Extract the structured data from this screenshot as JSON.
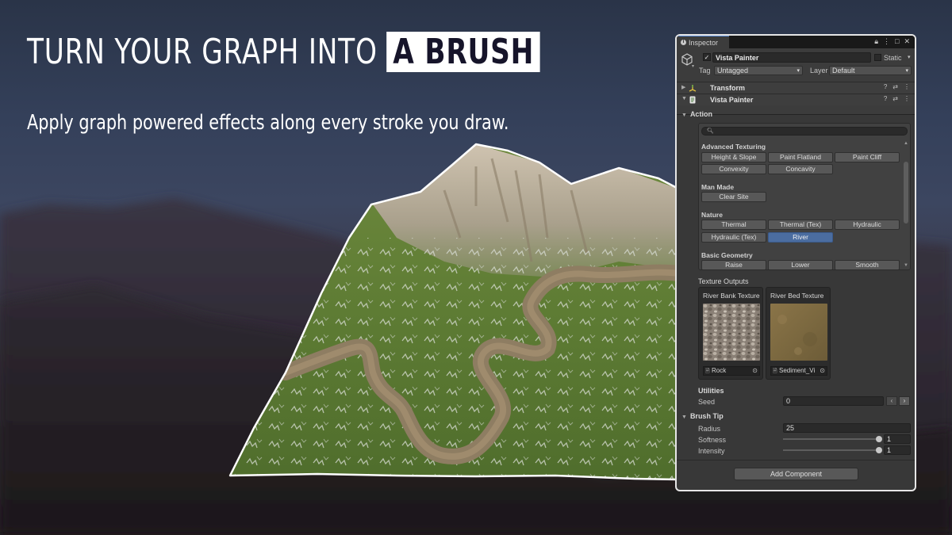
{
  "headline": {
    "part1": "TURN YOUR GRAPH INTO",
    "part2": "A BRUSH"
  },
  "subline": "Apply graph powered effects along every stroke you draw.",
  "inspector": {
    "tab_label": "Inspector",
    "tab_icons": [
      "lock-icon",
      "menu-dots-icon",
      "maximize-icon",
      "close-icon"
    ],
    "object": {
      "active": true,
      "name": "Vista Painter",
      "static_label": "Static",
      "tag_label": "Tag",
      "tag_value": "Untagged",
      "layer_label": "Layer",
      "layer_value": "Default"
    },
    "components": [
      {
        "name": "Transform",
        "icon": "transform-icon"
      },
      {
        "name": "Vista Painter",
        "icon": "script-icon"
      }
    ],
    "action": {
      "title": "Action",
      "search_placeholder": "",
      "groups": [
        {
          "title": "Advanced Texturing",
          "buttons": [
            "Height & Slope",
            "Paint Flatland",
            "Paint Cliff",
            "Convexity",
            "Concavity"
          ]
        },
        {
          "title": "Man Made",
          "buttons": [
            "Clear Site"
          ]
        },
        {
          "title": "Nature",
          "buttons": [
            "Thermal",
            "Thermal (Tex)",
            "Hydraulic",
            "Hydraulic (Tex)",
            "River"
          ]
        },
        {
          "title": "Basic Geometry",
          "buttons": [
            "Raise",
            "Lower",
            "Smooth"
          ]
        }
      ],
      "selected": "River"
    },
    "texture_outputs": {
      "title": "Texture Outputs",
      "items": [
        {
          "label": "River Bank Texture",
          "asset": "Rock"
        },
        {
          "label": "River Bed Texture",
          "asset": "Sediment_Vi"
        }
      ]
    },
    "utilities": {
      "title": "Utilities",
      "seed_label": "Seed",
      "seed_value": "0"
    },
    "brush_tip": {
      "title": "Brush Tip",
      "radius_label": "Radius",
      "radius_value": "25",
      "softness_label": "Softness",
      "softness_value": "1",
      "intensity_label": "Intensity",
      "intensity_value": "1"
    },
    "add_component_label": "Add Component"
  },
  "colors": {
    "accent_selected": "#4b6da0",
    "panel_bg": "#383838",
    "headline_box": "#ffffff",
    "headline_box_text": "#16142a"
  }
}
